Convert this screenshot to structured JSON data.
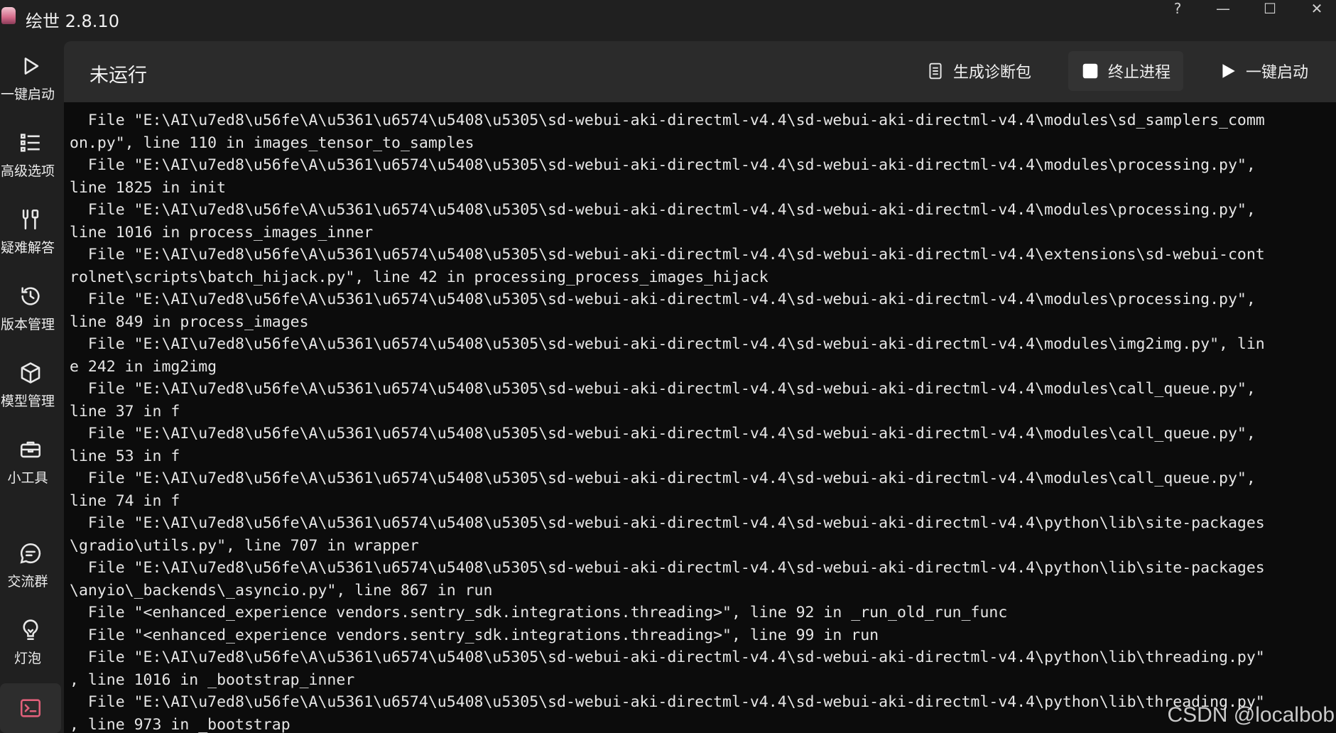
{
  "window": {
    "title": "绘世 2.8.10",
    "controls": [
      "?",
      "—",
      "☐",
      "✕"
    ]
  },
  "sidebar": {
    "items": [
      {
        "label": "一键启动",
        "icon": "play-icon"
      },
      {
        "label": "高级选项",
        "icon": "list-icon"
      },
      {
        "label": "疑难解答",
        "icon": "tools-icon"
      },
      {
        "label": "版本管理",
        "icon": "history-icon"
      },
      {
        "label": "模型管理",
        "icon": "cube-icon"
      },
      {
        "label": "小工具",
        "icon": "toolbox-icon"
      },
      {
        "label": "交流群",
        "icon": "chat-icon"
      },
      {
        "label": "灯泡",
        "icon": "bulb-icon"
      },
      {
        "label": "",
        "icon": "console-icon"
      }
    ]
  },
  "toolbar": {
    "status": "未运行",
    "diag_label": "生成诊断包",
    "stop_label": "终止进程",
    "launch_label": "一键启动"
  },
  "console": {
    "lines": [
      "  File \"E:\\AI\\u7ed8\\u56fe\\A\\u5361\\u6574\\u5408\\u5305\\sd-webui-aki-directml-v4.4\\sd-webui-aki-directml-v4.4\\modules\\sd_samplers_comm",
      "on.py\", line 110 in images_tensor_to_samples",
      "  File \"E:\\AI\\u7ed8\\u56fe\\A\\u5361\\u6574\\u5408\\u5305\\sd-webui-aki-directml-v4.4\\sd-webui-aki-directml-v4.4\\modules\\processing.py\",",
      "line 1825 in init",
      "  File \"E:\\AI\\u7ed8\\u56fe\\A\\u5361\\u6574\\u5408\\u5305\\sd-webui-aki-directml-v4.4\\sd-webui-aki-directml-v4.4\\modules\\processing.py\",",
      "line 1016 in process_images_inner",
      "  File \"E:\\AI\\u7ed8\\u56fe\\A\\u5361\\u6574\\u5408\\u5305\\sd-webui-aki-directml-v4.4\\sd-webui-aki-directml-v4.4\\extensions\\sd-webui-cont",
      "rolnet\\scripts\\batch_hijack.py\", line 42 in processing_process_images_hijack",
      "  File \"E:\\AI\\u7ed8\\u56fe\\A\\u5361\\u6574\\u5408\\u5305\\sd-webui-aki-directml-v4.4\\sd-webui-aki-directml-v4.4\\modules\\processing.py\",",
      "line 849 in process_images",
      "  File \"E:\\AI\\u7ed8\\u56fe\\A\\u5361\\u6574\\u5408\\u5305\\sd-webui-aki-directml-v4.4\\sd-webui-aki-directml-v4.4\\modules\\img2img.py\", lin",
      "e 242 in img2img",
      "  File \"E:\\AI\\u7ed8\\u56fe\\A\\u5361\\u6574\\u5408\\u5305\\sd-webui-aki-directml-v4.4\\sd-webui-aki-directml-v4.4\\modules\\call_queue.py\",",
      "line 37 in f",
      "  File \"E:\\AI\\u7ed8\\u56fe\\A\\u5361\\u6574\\u5408\\u5305\\sd-webui-aki-directml-v4.4\\sd-webui-aki-directml-v4.4\\modules\\call_queue.py\",",
      "line 53 in f",
      "  File \"E:\\AI\\u7ed8\\u56fe\\A\\u5361\\u6574\\u5408\\u5305\\sd-webui-aki-directml-v4.4\\sd-webui-aki-directml-v4.4\\modules\\call_queue.py\",",
      "line 74 in f",
      "  File \"E:\\AI\\u7ed8\\u56fe\\A\\u5361\\u6574\\u5408\\u5305\\sd-webui-aki-directml-v4.4\\sd-webui-aki-directml-v4.4\\python\\lib\\site-packages",
      "\\gradio\\utils.py\", line 707 in wrapper",
      "  File \"E:\\AI\\u7ed8\\u56fe\\A\\u5361\\u6574\\u5408\\u5305\\sd-webui-aki-directml-v4.4\\sd-webui-aki-directml-v4.4\\python\\lib\\site-packages",
      "\\anyio\\_backends\\_asyncio.py\", line 867 in run",
      "  File \"<enhanced_experience vendors.sentry_sdk.integrations.threading>\", line 92 in _run_old_run_func",
      "  File \"<enhanced_experience vendors.sentry_sdk.integrations.threading>\", line 99 in run",
      "  File \"E:\\AI\\u7ed8\\u56fe\\A\\u5361\\u6574\\u5408\\u5305\\sd-webui-aki-directml-v4.4\\sd-webui-aki-directml-v4.4\\python\\lib\\threading.py\"",
      ", line 1016 in _bootstrap_inner",
      "  File \"E:\\AI\\u7ed8\\u56fe\\A\\u5361\\u6574\\u5408\\u5305\\sd-webui-aki-directml-v4.4\\sd-webui-aki-directml-v4.4\\python\\lib\\threading.py\"",
      ", line 973 in _bootstrap"
    ]
  },
  "watermark": "CSDN @localbob",
  "colors": {
    "background": "#202020",
    "panel": "#2b2b2b",
    "console_bg": "#0c0c0c",
    "text": "#e6e6e6"
  }
}
